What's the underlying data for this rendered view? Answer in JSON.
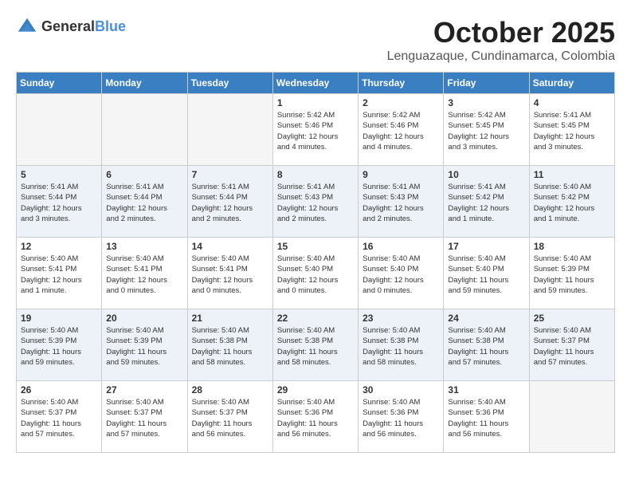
{
  "header": {
    "logo_general": "General",
    "logo_blue": "Blue",
    "month": "October 2025",
    "location": "Lenguazaque, Cundinamarca, Colombia"
  },
  "weekdays": [
    "Sunday",
    "Monday",
    "Tuesday",
    "Wednesday",
    "Thursday",
    "Friday",
    "Saturday"
  ],
  "weeks": [
    [
      {
        "day": "",
        "info": ""
      },
      {
        "day": "",
        "info": ""
      },
      {
        "day": "",
        "info": ""
      },
      {
        "day": "1",
        "info": "Sunrise: 5:42 AM\nSunset: 5:46 PM\nDaylight: 12 hours\nand 4 minutes."
      },
      {
        "day": "2",
        "info": "Sunrise: 5:42 AM\nSunset: 5:46 PM\nDaylight: 12 hours\nand 4 minutes."
      },
      {
        "day": "3",
        "info": "Sunrise: 5:42 AM\nSunset: 5:45 PM\nDaylight: 12 hours\nand 3 minutes."
      },
      {
        "day": "4",
        "info": "Sunrise: 5:41 AM\nSunset: 5:45 PM\nDaylight: 12 hours\nand 3 minutes."
      }
    ],
    [
      {
        "day": "5",
        "info": "Sunrise: 5:41 AM\nSunset: 5:44 PM\nDaylight: 12 hours\nand 3 minutes."
      },
      {
        "day": "6",
        "info": "Sunrise: 5:41 AM\nSunset: 5:44 PM\nDaylight: 12 hours\nand 2 minutes."
      },
      {
        "day": "7",
        "info": "Sunrise: 5:41 AM\nSunset: 5:44 PM\nDaylight: 12 hours\nand 2 minutes."
      },
      {
        "day": "8",
        "info": "Sunrise: 5:41 AM\nSunset: 5:43 PM\nDaylight: 12 hours\nand 2 minutes."
      },
      {
        "day": "9",
        "info": "Sunrise: 5:41 AM\nSunset: 5:43 PM\nDaylight: 12 hours\nand 2 minutes."
      },
      {
        "day": "10",
        "info": "Sunrise: 5:41 AM\nSunset: 5:42 PM\nDaylight: 12 hours\nand 1 minute."
      },
      {
        "day": "11",
        "info": "Sunrise: 5:40 AM\nSunset: 5:42 PM\nDaylight: 12 hours\nand 1 minute."
      }
    ],
    [
      {
        "day": "12",
        "info": "Sunrise: 5:40 AM\nSunset: 5:41 PM\nDaylight: 12 hours\nand 1 minute."
      },
      {
        "day": "13",
        "info": "Sunrise: 5:40 AM\nSunset: 5:41 PM\nDaylight: 12 hours\nand 0 minutes."
      },
      {
        "day": "14",
        "info": "Sunrise: 5:40 AM\nSunset: 5:41 PM\nDaylight: 12 hours\nand 0 minutes."
      },
      {
        "day": "15",
        "info": "Sunrise: 5:40 AM\nSunset: 5:40 PM\nDaylight: 12 hours\nand 0 minutes."
      },
      {
        "day": "16",
        "info": "Sunrise: 5:40 AM\nSunset: 5:40 PM\nDaylight: 12 hours\nand 0 minutes."
      },
      {
        "day": "17",
        "info": "Sunrise: 5:40 AM\nSunset: 5:40 PM\nDaylight: 11 hours\nand 59 minutes."
      },
      {
        "day": "18",
        "info": "Sunrise: 5:40 AM\nSunset: 5:39 PM\nDaylight: 11 hours\nand 59 minutes."
      }
    ],
    [
      {
        "day": "19",
        "info": "Sunrise: 5:40 AM\nSunset: 5:39 PM\nDaylight: 11 hours\nand 59 minutes."
      },
      {
        "day": "20",
        "info": "Sunrise: 5:40 AM\nSunset: 5:39 PM\nDaylight: 11 hours\nand 59 minutes."
      },
      {
        "day": "21",
        "info": "Sunrise: 5:40 AM\nSunset: 5:38 PM\nDaylight: 11 hours\nand 58 minutes."
      },
      {
        "day": "22",
        "info": "Sunrise: 5:40 AM\nSunset: 5:38 PM\nDaylight: 11 hours\nand 58 minutes."
      },
      {
        "day": "23",
        "info": "Sunrise: 5:40 AM\nSunset: 5:38 PM\nDaylight: 11 hours\nand 58 minutes."
      },
      {
        "day": "24",
        "info": "Sunrise: 5:40 AM\nSunset: 5:38 PM\nDaylight: 11 hours\nand 57 minutes."
      },
      {
        "day": "25",
        "info": "Sunrise: 5:40 AM\nSunset: 5:37 PM\nDaylight: 11 hours\nand 57 minutes."
      }
    ],
    [
      {
        "day": "26",
        "info": "Sunrise: 5:40 AM\nSunset: 5:37 PM\nDaylight: 11 hours\nand 57 minutes."
      },
      {
        "day": "27",
        "info": "Sunrise: 5:40 AM\nSunset: 5:37 PM\nDaylight: 11 hours\nand 57 minutes."
      },
      {
        "day": "28",
        "info": "Sunrise: 5:40 AM\nSunset: 5:37 PM\nDaylight: 11 hours\nand 56 minutes."
      },
      {
        "day": "29",
        "info": "Sunrise: 5:40 AM\nSunset: 5:36 PM\nDaylight: 11 hours\nand 56 minutes."
      },
      {
        "day": "30",
        "info": "Sunrise: 5:40 AM\nSunset: 5:36 PM\nDaylight: 11 hours\nand 56 minutes."
      },
      {
        "day": "31",
        "info": "Sunrise: 5:40 AM\nSunset: 5:36 PM\nDaylight: 11 hours\nand 56 minutes."
      },
      {
        "day": "",
        "info": ""
      }
    ]
  ]
}
